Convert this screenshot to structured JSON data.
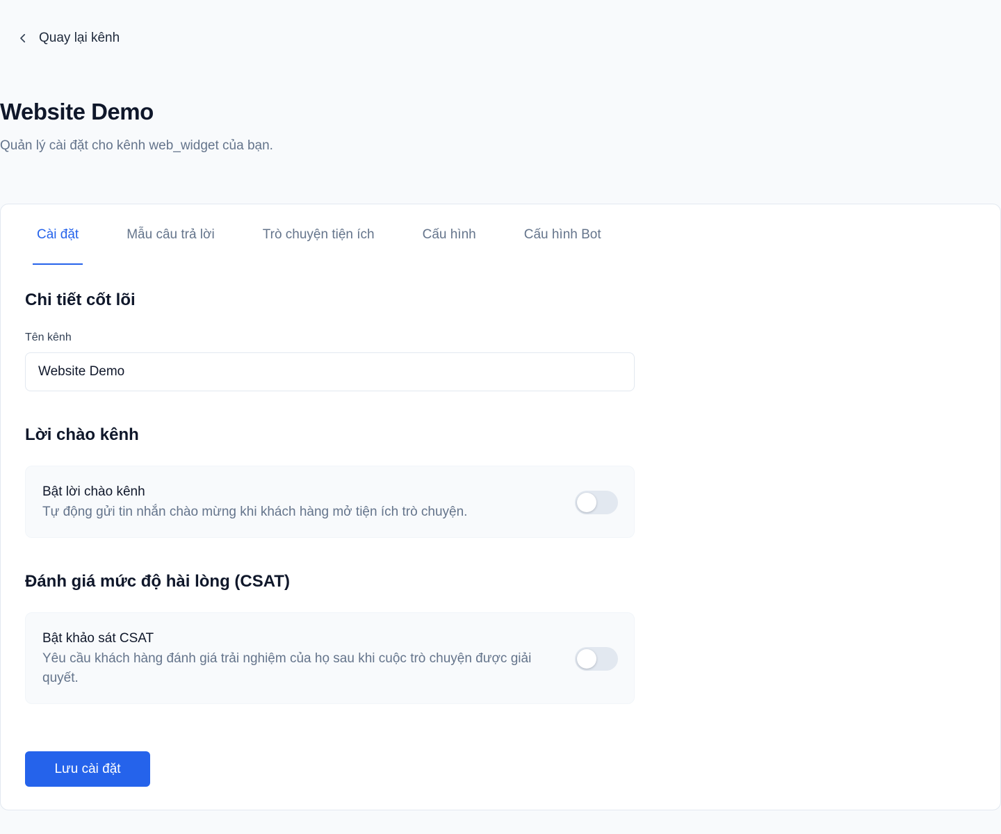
{
  "nav": {
    "back_label": "Quay lại kênh"
  },
  "header": {
    "title": "Website Demo",
    "subtitle": "Quản lý cài đặt cho kênh web_widget của bạn."
  },
  "tabs": [
    {
      "label": "Cài đặt",
      "active": true
    },
    {
      "label": "Mẫu câu trả lời",
      "active": false
    },
    {
      "label": "Trò chuyện tiện ích",
      "active": false
    },
    {
      "label": "Cấu hình",
      "active": false
    },
    {
      "label": "Cấu hình Bot",
      "active": false
    }
  ],
  "core": {
    "title": "Chi tiết cốt lõi",
    "channel_name_label": "Tên kênh",
    "channel_name_value": "Website Demo"
  },
  "greeting": {
    "title": "Lời chào kênh",
    "toggle_title": "Bật lời chào kênh",
    "toggle_desc": "Tự động gửi tin nhắn chào mừng khi khách hàng mở tiện ích trò chuyện.",
    "enabled": false
  },
  "csat": {
    "title": "Đánh giá mức độ hài lòng (CSAT)",
    "toggle_title": "Bật khảo sát CSAT",
    "toggle_desc": "Yêu cầu khách hàng đánh giá trải nghiệm của họ sau khi cuộc trò chuyện được giải quyết.",
    "enabled": false
  },
  "actions": {
    "save_label": "Lưu cài đặt"
  },
  "colors": {
    "accent": "#2563eb",
    "page_bg": "#f8fafc",
    "muted_text": "#64748b"
  }
}
